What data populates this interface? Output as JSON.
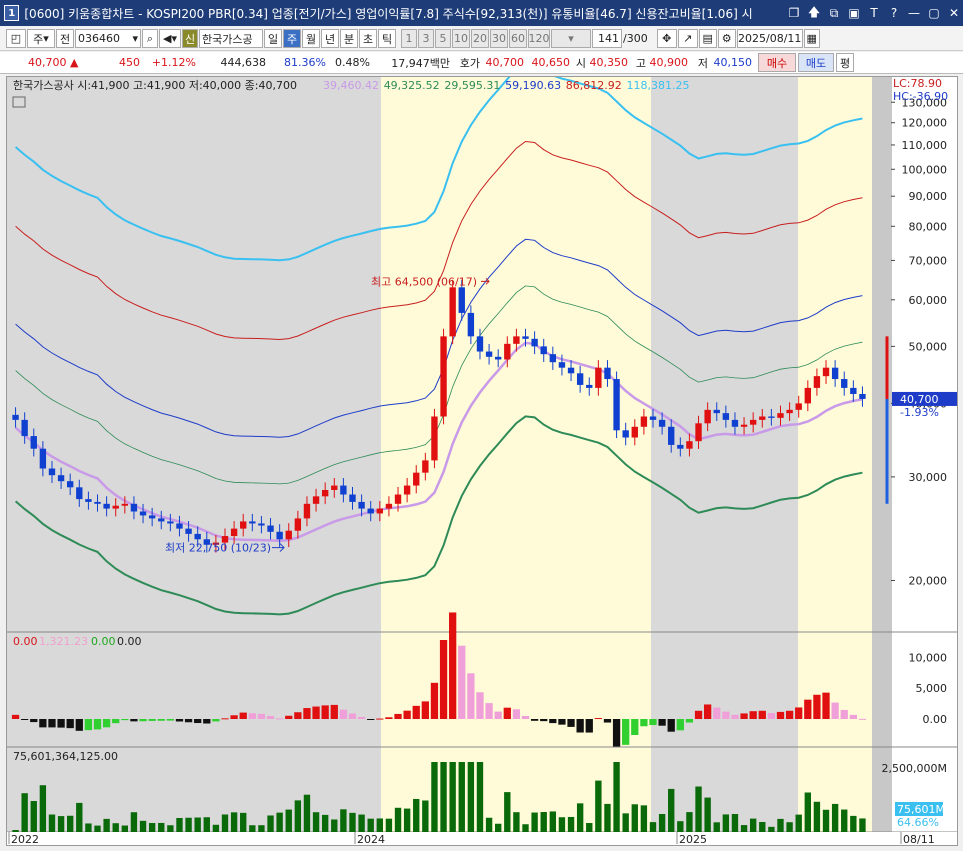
{
  "title": {
    "text": "[0600] 키움종합차트 - KOSPI200 PBR[0.34] 업종[전기/가스] 영업이익률[7.8] 주식수[92,313(천)] 유통비율[46.7] 신용잔고비율[1.06] 시",
    "num": "1",
    "buttons": [
      "❐",
      "🡅",
      "⧉",
      "▣",
      "T",
      "?",
      "—",
      "▢",
      "✕"
    ]
  },
  "toolbar": {
    "period_type": "주",
    "label_jeon": "전",
    "code": "036460",
    "name_badge": "신",
    "name": "한국가스공",
    "periods": [
      "일",
      "주",
      "월",
      "년",
      "분",
      "초",
      "틱"
    ],
    "active_period": "주",
    "nums": [
      "1",
      "3",
      "5",
      "10",
      "20",
      "30",
      "60",
      "120"
    ],
    "count": "141",
    "count_total": "/300",
    "date": "2025/08/11"
  },
  "quote": {
    "price": "40,700",
    "arrow": "▲",
    "change": "450",
    "pct": "+1.12%",
    "volume": "444,638",
    "ratio": "81.36%",
    "turnover": "0.48%",
    "amount": "17,947백만",
    "ask_label": "호가",
    "ask": "40,700",
    "bid": "40,650",
    "open_label": "시",
    "open": "40,350",
    "high_label": "고",
    "high": "40,900",
    "low_label": "저",
    "low": "40,150",
    "buy": "매수",
    "sell": "매도",
    "eval": "평"
  },
  "legend": {
    "main": "한국가스공사 시:41,900 고:41,900 저:40,000 종:40,700",
    "ma": [
      {
        "text": "39,460.42",
        "color": "#c89ae8"
      },
      {
        "text": "49,325.52",
        "color": "#2e8b57"
      },
      {
        "text": "29,595.31",
        "color": "#2e8b57"
      },
      {
        "text": "59,190.63",
        "color": "#1e3cc8"
      },
      {
        "text": "86,812.92",
        "color": "#c81e1e"
      },
      {
        "text": "118,381.25",
        "color": "#3ac0f0"
      }
    ],
    "lc": "LC:78.90",
    "hc": "HC:-36.90",
    "ind_title": [
      "0.00",
      "1,321.23",
      "0.00",
      "0.00"
    ],
    "vol_title": "75,601,364,125.00"
  },
  "annotations": {
    "high": "최고 64,500 (06/17)",
    "low": "최저 22,750 (10/23)",
    "cur_price": "40,700",
    "cur_pct": "-1.93%",
    "vol_cur": "75,601M",
    "vol_pct": "64.66%"
  },
  "xaxis": [
    "2022",
    "2024",
    "2025",
    "08/11"
  ],
  "chart_data": {
    "type": "candlestick",
    "yaxis_ticks": [
      130000,
      120000,
      110000,
      100000,
      90000,
      80000,
      70000,
      60000,
      50000,
      40000,
      30000,
      20000
    ],
    "indicator_ticks": [
      "10,000",
      "5,000",
      "0.00"
    ],
    "volume_ticks": [
      "2,500,000M"
    ],
    "series": [
      {
        "name": "close",
        "values": [
          37500,
          35200,
          33500,
          31000,
          30200,
          29500,
          28800,
          27500,
          27200,
          27000,
          26500,
          26800,
          27000,
          26200,
          25800,
          25500,
          25200,
          25000,
          24500,
          24000,
          23500,
          23000,
          23200,
          23800,
          24500,
          25200,
          25000,
          24800,
          24200,
          23500,
          24300,
          25500,
          27000,
          27800,
          28500,
          29000,
          28000,
          27200,
          26500,
          26000,
          26500,
          27000,
          28000,
          29000,
          30500,
          32000,
          38000,
          52000,
          63000,
          57000,
          52000,
          49000,
          48000,
          47500,
          50500,
          52000,
          51500,
          50000,
          48500,
          47000,
          46000,
          45000,
          43000,
          42500,
          46000,
          44000,
          36000,
          35000,
          36500,
          38000,
          37500,
          36500,
          34000,
          33500,
          34500,
          37000,
          39000,
          38500,
          37500,
          36500,
          36800,
          37500,
          38000,
          37800,
          38500,
          39000,
          40000,
          42500,
          44500,
          46000,
          44000,
          42500,
          41500,
          40700
        ]
      }
    ]
  }
}
